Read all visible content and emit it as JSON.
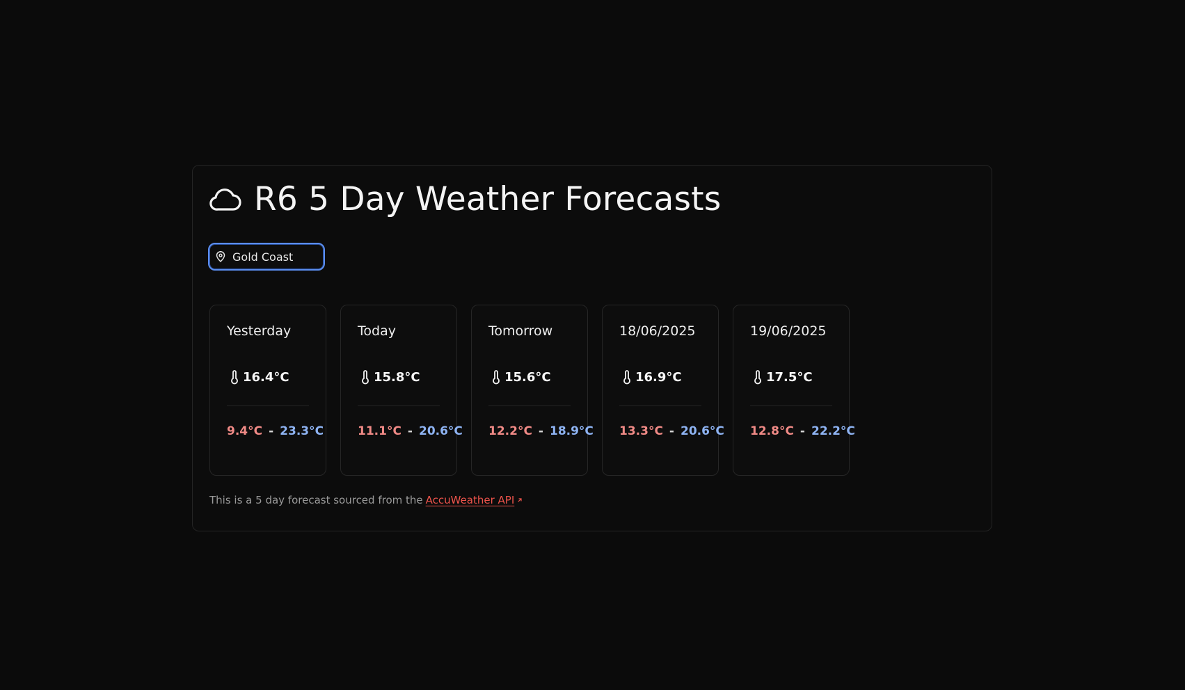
{
  "header": {
    "title": "R6 5 Day Weather Forecasts",
    "icon": "cloud-icon"
  },
  "location": {
    "value": "Gold Coast",
    "icon": "map-pin-icon"
  },
  "forecast": [
    {
      "day": "Yesterday",
      "temp": "16.4°C",
      "min": "9.4°C",
      "max": "23.3°C"
    },
    {
      "day": "Today",
      "temp": "15.8°C",
      "min": "11.1°C",
      "max": "20.6°C"
    },
    {
      "day": "Tomorrow",
      "temp": "15.6°C",
      "min": "12.2°C",
      "max": "18.9°C"
    },
    {
      "day": "18/06/2025",
      "temp": "16.9°C",
      "min": "13.3°C",
      "max": "20.6°C"
    },
    {
      "day": "19/06/2025",
      "temp": "17.5°C",
      "min": "12.8°C",
      "max": "22.2°C"
    }
  ],
  "range_separator": "-",
  "footer": {
    "text": "This is a 5 day forecast sourced from the",
    "link_label": "AccuWeather API"
  },
  "colors": {
    "background": "#0b0b0b",
    "min_temp": "#f08a86",
    "max_temp": "#8eb3f2",
    "link": "#f0544c",
    "focus_ring": "#5b8ef0"
  }
}
